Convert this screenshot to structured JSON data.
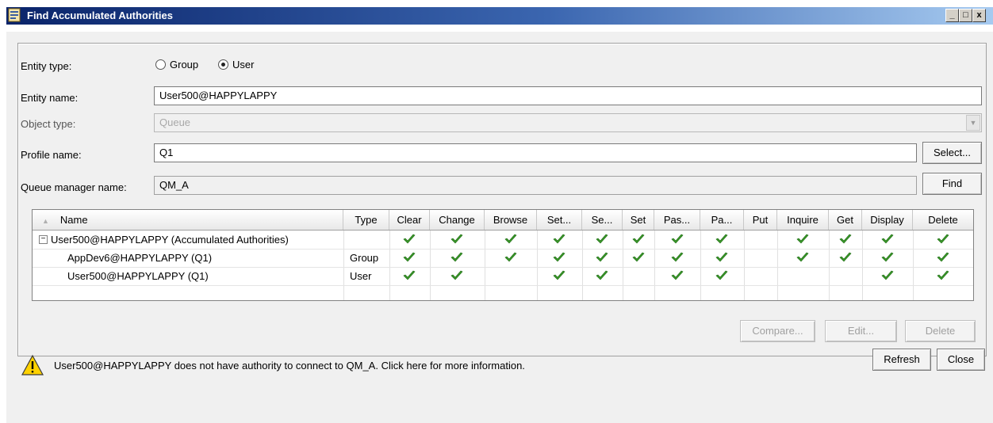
{
  "window": {
    "title": "Find Accumulated Authorities",
    "controls": [
      "_",
      "□",
      "x"
    ]
  },
  "form": {
    "entity_type_label": "Entity type:",
    "group_label": "Group",
    "user_label": "User",
    "selected_entity_type": "User",
    "entity_name_label": "Entity name:",
    "entity_name_value": "User500@HAPPYLAPPY",
    "object_type_label": "Object type:",
    "object_type_value": "Queue",
    "profile_name_label": "Profile name:",
    "profile_name_value": "Q1",
    "select_button": "Select...",
    "qm_label": "Queue manager name:",
    "qm_value": "QM_A",
    "find_button": "Find"
  },
  "table": {
    "columns": [
      "Name",
      "Type",
      "Clear",
      "Change",
      "Browse",
      "Set...",
      "Se...",
      "Set",
      "Pas...",
      "Pa...",
      "Put",
      "Inquire",
      "Get",
      "Display",
      "Delete"
    ],
    "rows": [
      {
        "name": "User500@HAPPYLAPPY (Accumulated Authorities)",
        "type": "",
        "expanded": true,
        "checks": [
          true,
          true,
          true,
          true,
          true,
          true,
          true,
          true,
          false,
          true,
          true,
          true,
          true
        ]
      },
      {
        "name": "AppDev6@HAPPYLAPPY (Q1)",
        "type": "Group",
        "checks": [
          true,
          true,
          true,
          true,
          true,
          true,
          true,
          true,
          false,
          true,
          true,
          true,
          true
        ]
      },
      {
        "name": "User500@HAPPYLAPPY (Q1)",
        "type": "User",
        "checks": [
          true,
          true,
          false,
          true,
          true,
          false,
          true,
          true,
          false,
          false,
          false,
          true,
          true
        ]
      }
    ],
    "check_color": "#3a9a2a"
  },
  "actions": {
    "compare": "Compare...",
    "edit": "Edit...",
    "delete": "Delete"
  },
  "footer": {
    "warning_icon": "warning-triangle-icon",
    "message": "User500@HAPPYLAPPY does not have authority to connect to QM_A. Click here for more information.",
    "refresh": "Refresh",
    "close": "Close"
  }
}
